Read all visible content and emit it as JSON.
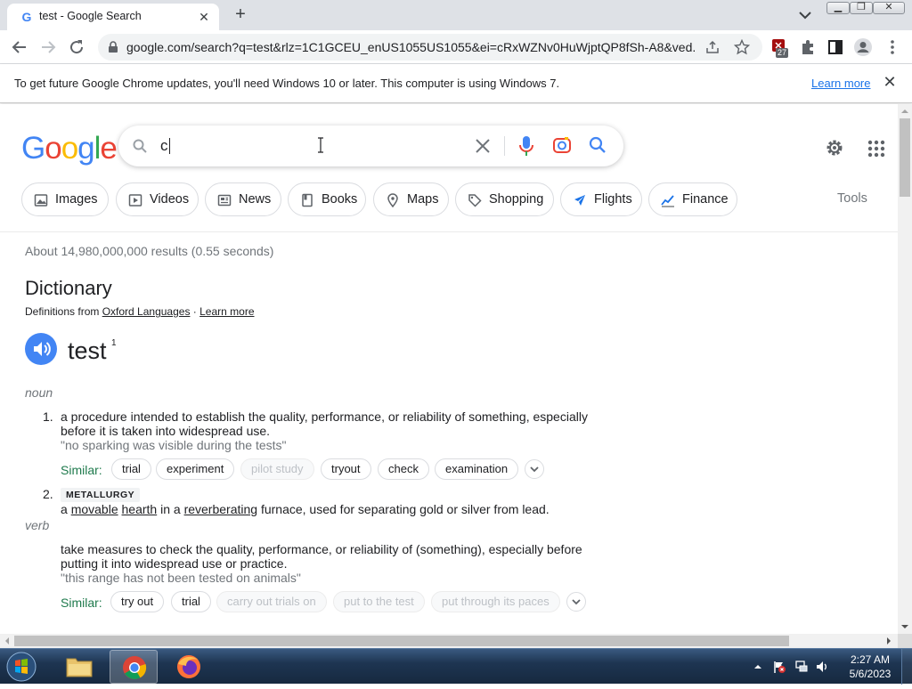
{
  "browser": {
    "tab_title": "test - Google Search",
    "tab_favicon": "G",
    "url": "google.com/search?q=test&rlz=1C1GCEU_enUS1055US1055&ei=cRxWZNv0HuWjptQP8fSh-A8&ved...",
    "extension_badge": "27"
  },
  "infobar": {
    "message": "To get future Google Chrome updates, you'll need Windows 10 or later. This computer is using Windows 7.",
    "learn_more": "Learn more"
  },
  "logo": {
    "letters": [
      "G",
      "o",
      "o",
      "g",
      "l",
      "e"
    ],
    "colors": [
      "#4285f4",
      "#ea4335",
      "#fbbc05",
      "#4285f4",
      "#34a853",
      "#ea4335"
    ]
  },
  "search": {
    "value": "c"
  },
  "chips": [
    {
      "label": "Images",
      "icon": "image-icon"
    },
    {
      "label": "Videos",
      "icon": "video-icon"
    },
    {
      "label": "News",
      "icon": "news-icon"
    },
    {
      "label": "Books",
      "icon": "book-icon"
    },
    {
      "label": "Maps",
      "icon": "map-pin-icon"
    },
    {
      "label": "Shopping",
      "icon": "tag-icon"
    },
    {
      "label": "Flights",
      "icon": "plane-icon"
    },
    {
      "label": "Finance",
      "icon": "chart-icon"
    }
  ],
  "tools_label": "Tools",
  "result_stats": "About 14,980,000,000 results (0.55 seconds)",
  "dictionary": {
    "title": "Dictionary",
    "source_prefix": "Definitions from ",
    "source_name": "Oxford Languages",
    "source_sep": " · ",
    "learn_more": "Learn more",
    "headword": "test",
    "headword_sup": "1",
    "noun": {
      "label": "noun",
      "senses": [
        {
          "num": "1.",
          "definition": "a procedure intended to establish the quality, performance, or reliability of something, especially before it is taken into widespread use.",
          "example": "\"no sparking was visible during the tests\"",
          "similar_label": "Similar:",
          "similar": [
            "trial",
            "experiment",
            "pilot study",
            "tryout",
            "check",
            "examination"
          ]
        },
        {
          "num": "2.",
          "tag": "METALLURGY",
          "def_parts": [
            "a ",
            "movable",
            " ",
            "hearth",
            " in a ",
            "reverberating",
            " furnace, used for separating gold or silver from lead."
          ]
        }
      ]
    },
    "verb": {
      "label": "verb",
      "definition": "take measures to check the quality, performance, or reliability of (something), especially before putting it into widespread use or practice.",
      "example": "\"this range has not been tested on animals\"",
      "similar_label": "Similar:",
      "similar": [
        "try out",
        "trial",
        "carry out trials on",
        "put to the test",
        "put through its paces"
      ]
    }
  },
  "taskbar": {
    "time": "2:27 AM",
    "date": "5/6/2023"
  }
}
